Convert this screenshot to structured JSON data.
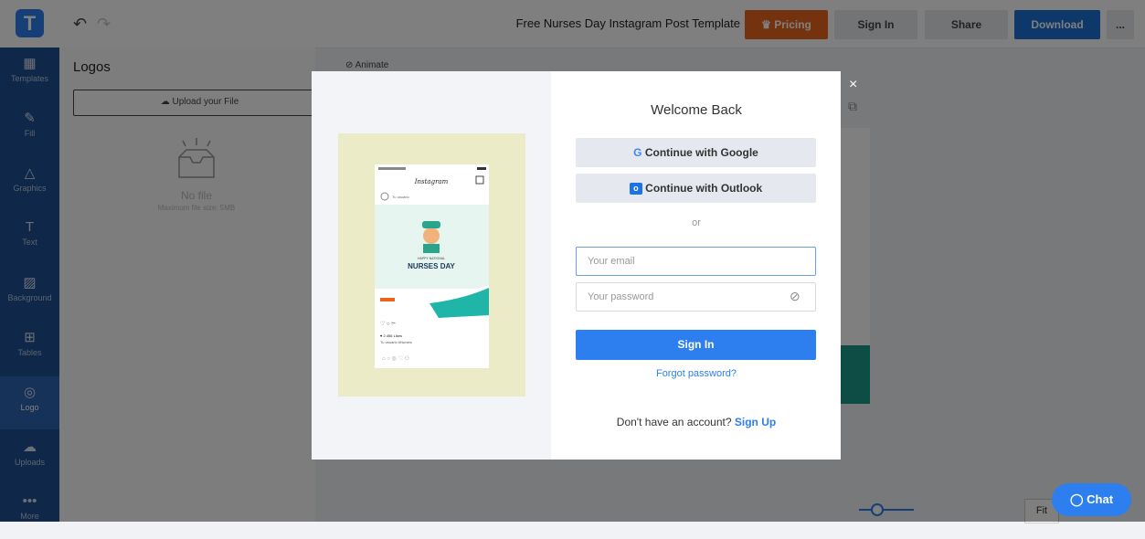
{
  "header": {
    "logo_letter": "T",
    "undo_icon": "undo-icon",
    "redo_icon": "redo-icon",
    "document_title": "Free Nurses Day Instagram Post Template",
    "pricing_label": "Pricing",
    "signin_label": "Sign In",
    "share_label": "Share",
    "download_label": "Download",
    "more_label": "..."
  },
  "sidebar": {
    "items": [
      {
        "label": "Templates",
        "icon": "templates-icon"
      },
      {
        "label": "Fill",
        "icon": "fill-icon"
      },
      {
        "label": "Graphics",
        "icon": "graphics-icon"
      },
      {
        "label": "Text",
        "icon": "text-icon"
      },
      {
        "label": "Background",
        "icon": "background-icon"
      },
      {
        "label": "Tables",
        "icon": "tables-icon"
      },
      {
        "label": "Logo",
        "icon": "logo-icon"
      },
      {
        "label": "Uploads",
        "icon": "uploads-icon"
      },
      {
        "label": "More",
        "icon": "more-icon"
      }
    ]
  },
  "panel": {
    "title": "Logos",
    "upload_label": "Upload your File",
    "empty_title": "No file",
    "empty_subtitle": "Maximum file size: 5MB"
  },
  "canvas": {
    "animate_label": "Animate",
    "fit_label": "Fit",
    "chat_label": "Chat"
  },
  "modal": {
    "title": "Welcome Back",
    "google_label": "Continue with Google",
    "outlook_label": "Continue with Outlook",
    "or_label": "or",
    "email_placeholder": "Your email",
    "password_placeholder": "Your password",
    "signin_label": "Sign In",
    "forgot_label": "Forgot password?",
    "no_account_label": "Don't have an account?",
    "signup_label": "Sign Up",
    "close_label": "×"
  },
  "preview": {
    "app_name": "Instagram",
    "account": "Tu usuario",
    "banner_top": "HAPPY NATIONAL",
    "banner_title": "NURSES DAY",
    "likes": "♥ 2.456 Likes",
    "caption": "Tu usuario #Nurses"
  },
  "colors": {
    "brand_blue": "#2d7ff0",
    "sidebar_blue": "#1f4f93",
    "pricing_orange": "#e8651c",
    "preview_bg": "#ecebc7",
    "teal": "#1fb5a8"
  }
}
